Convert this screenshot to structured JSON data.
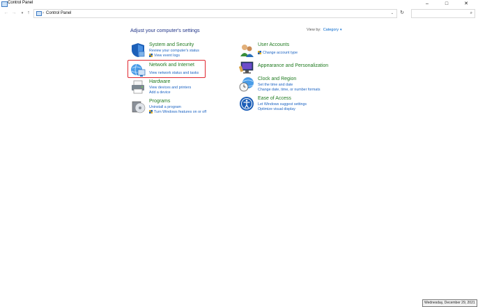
{
  "window": {
    "title": "Control Panel",
    "controls": {
      "minimize": "–",
      "maximize": "□",
      "close": "✕"
    }
  },
  "nav": {
    "back": "←",
    "forward": "→",
    "recent": "▾",
    "up": "↑",
    "address_sep": "›",
    "address_text": "Control Panel",
    "address_dropdown": "⌄",
    "refresh": "↻",
    "search_icon": "⌕"
  },
  "main": {
    "heading": "Adjust your computer's settings",
    "view_by_label": "View by:",
    "view_by_value": "Category",
    "view_by_caret": "▾"
  },
  "categories_left": [
    {
      "title": "System and Security",
      "links": [
        "Review your computer's status",
        "View event logs"
      ],
      "icon": "shield-icon"
    },
    {
      "title": "Network and Internet",
      "links": [
        "View network status and tasks"
      ],
      "icon": "network-globe-icon"
    },
    {
      "title": "Hardware",
      "links": [
        "View devices and printers",
        "Add a device"
      ],
      "icon": "printer-icon"
    },
    {
      "title": "Programs",
      "links": [
        "Uninstall a program",
        "Turn Windows features on or off"
      ],
      "icon": "programs-disc-icon"
    }
  ],
  "categories_right": [
    {
      "title": "User Accounts",
      "links": [
        "Change account type"
      ],
      "icon": "users-icon"
    },
    {
      "title": "Appearance and Personalization",
      "links": [],
      "icon": "monitor-paint-icon"
    },
    {
      "title": "Clock and Region",
      "links": [
        "Set the time and date",
        "Change date, time, or number formats"
      ],
      "icon": "clock-globe-icon"
    },
    {
      "title": "Ease of Access",
      "links": [
        "Let Windows suggest settings",
        "Optimize visual display"
      ],
      "icon": "ease-of-access-icon"
    }
  ],
  "tooltip": {
    "date": "Wednesday, December 29, 2021"
  },
  "colors": {
    "category_title": "#1f7a1f",
    "link": "#1a62c2",
    "heading": "#1e3287",
    "highlight_border": "#e0252e"
  }
}
